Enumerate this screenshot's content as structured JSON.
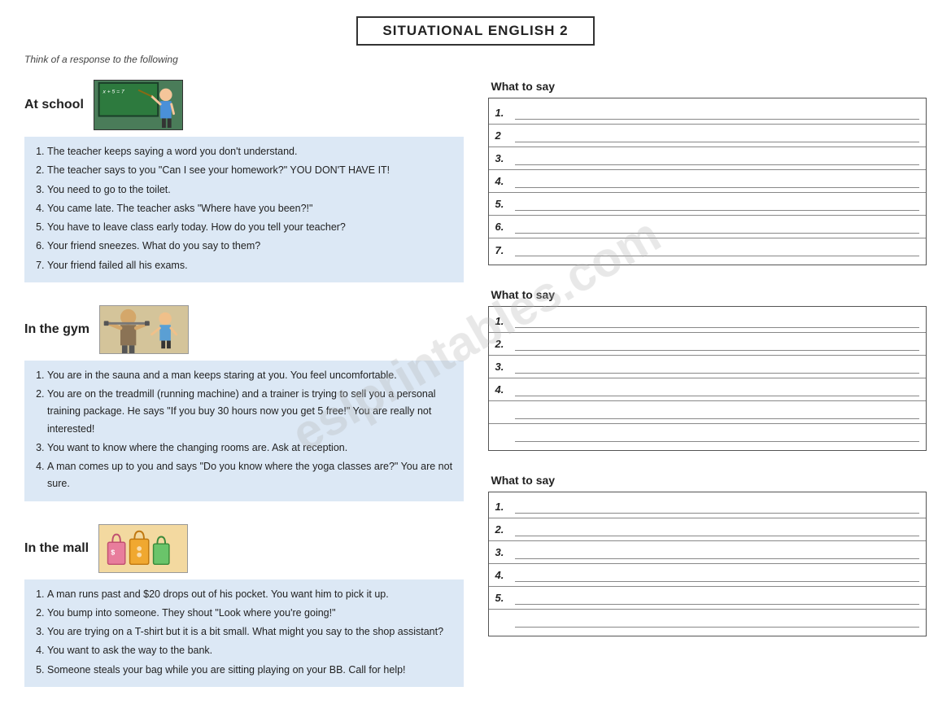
{
  "page": {
    "title": "SITUATIONAL ENGLISH 2",
    "subtitle": "Think of a response to the following"
  },
  "sections": [
    {
      "id": "at-school",
      "title": "At school",
      "image_label": "teacher-chalkboard",
      "items": [
        "The teacher keeps saying a word you don't understand.",
        "The teacher says to you \"Can I see your homework?\" YOU DON'T HAVE IT!",
        "You need to go to the toilet.",
        "You came late. The teacher asks \"Where have you been?!\"",
        "You have to leave class early today. How do you tell your teacher?",
        "Your friend sneezes. What do you say to them?",
        "Your friend failed all his exams."
      ],
      "answer_count": 7
    },
    {
      "id": "in-the-gym",
      "title": "In the gym",
      "image_label": "gym-figures",
      "items": [
        "You are in the sauna and a man keeps staring at you. You feel uncomfortable.",
        "You are on the treadmill (running machine) and a trainer is trying to sell you a personal training package. He says \"If you buy 30 hours now you get 5 free!\" You are really not interested!",
        "You want to know where the changing rooms are. Ask at reception.",
        "A man comes up to you and says \"Do you know where the yoga classes are?\" You are not sure."
      ],
      "answer_count": 4
    },
    {
      "id": "in-the-mall",
      "title": "In the mall",
      "image_label": "shopping-bags",
      "items": [
        "A man runs past and $20 drops out of his pocket. You want him to pick it up.",
        "You bump into someone. They shout \"Look where you're going!\"",
        "You are trying on a T-shirt but it is a bit small. What might you say to the shop assistant?",
        "You want to ask the way to the bank.",
        "Someone steals your bag while you are sitting playing on your BB. Call for help!"
      ],
      "answer_count": 5
    }
  ],
  "what_to_say_label": "What to say",
  "answer_numbers": {
    "school": [
      "1.",
      "2",
      "3.",
      "4.",
      "5.",
      "6.",
      "7."
    ],
    "gym": [
      "1.",
      "2.",
      "3.",
      "4."
    ],
    "mall": [
      "1.",
      "2.",
      "3.",
      "4.",
      "5."
    ]
  }
}
